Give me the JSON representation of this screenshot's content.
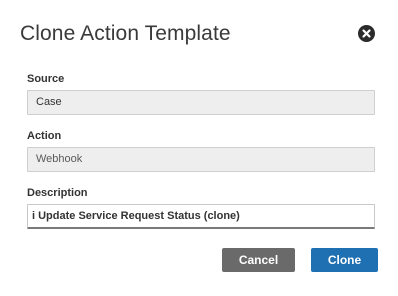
{
  "dialog": {
    "title": "Clone Action Template",
    "close_icon": "close-circle-icon"
  },
  "fields": {
    "source": {
      "label": "Source",
      "value": "Case"
    },
    "action": {
      "label": "Action",
      "value": "Webhook"
    },
    "description": {
      "label": "Description",
      "value": "i Update Service Request Status (clone)"
    }
  },
  "buttons": {
    "cancel_label": "Cancel",
    "clone_label": "Clone"
  },
  "colors": {
    "primary": "#1f6fb3",
    "secondary": "#6a6a6a",
    "readonly_bg": "#eeeeee"
  }
}
